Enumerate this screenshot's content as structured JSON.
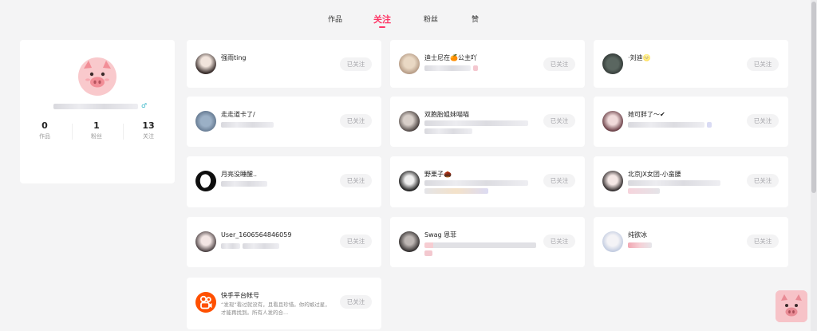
{
  "tabs": [
    {
      "label": "作品"
    },
    {
      "label": "关注"
    },
    {
      "label": "粉丝"
    },
    {
      "label": "赞"
    }
  ],
  "active_tab": "关注",
  "profile": {
    "gender_icon": "♂",
    "stats": [
      {
        "num": "0",
        "label": "作品"
      },
      {
        "num": "1",
        "label": "粉丝"
      },
      {
        "num": "13",
        "label": "关注"
      }
    ]
  },
  "follow_button_label": "已关注",
  "following": [
    {
      "name": "强雨ting"
    },
    {
      "name": "迪士尼在🍊公主吖"
    },
    {
      "name": "·刘迪🌝"
    },
    {
      "name": "走走道卡了/"
    },
    {
      "name": "双胞胎姐妹喵喵"
    },
    {
      "name": "她可胖了～✔"
    },
    {
      "name": "月亮没睡醒.."
    },
    {
      "name": "野栗子🌰"
    },
    {
      "name": "北京JX女团-小蛮腰"
    },
    {
      "name": "User_1606564846059"
    },
    {
      "name": "Swag 恩菲"
    },
    {
      "name": "纯欲冰"
    },
    {
      "name": "快手平台帐号",
      "desc": "“发现”看过就没有，且看且珍惜。你的嫉过星，才能再找到。所有人发的合..."
    }
  ],
  "colors": {
    "accent": "#fe3666",
    "kuaishou_orange": "#ff5000",
    "pig_pink": "#f6b8bd"
  },
  "icons": {
    "profile_avatar": "pig-face-icon",
    "floating": "pig-face-icon",
    "gender": "male-gender-icon"
  }
}
